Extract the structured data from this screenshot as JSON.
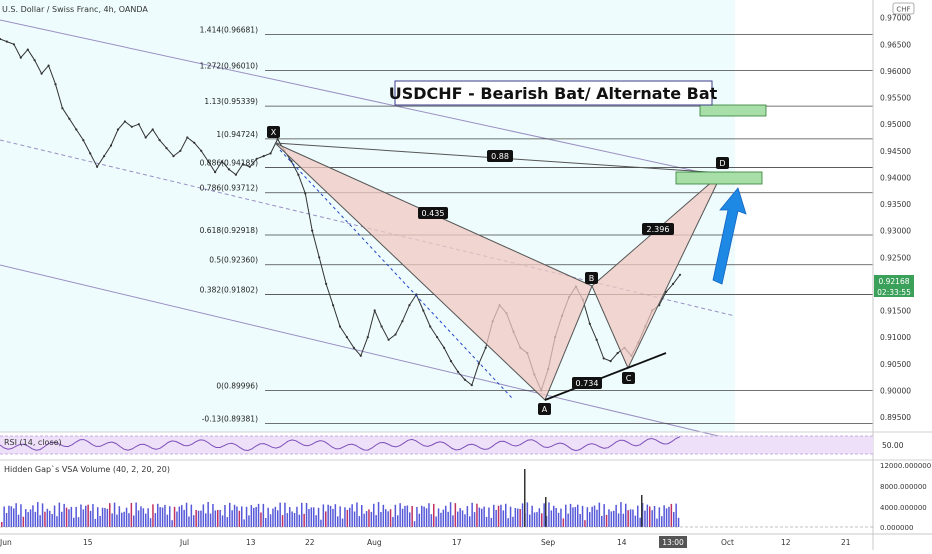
{
  "header": {
    "symbol_title": "U.S. Dollar / Swiss Franc, 4h, OANDA",
    "currency_badge": "CHF"
  },
  "annotation_title": "USDCHF - Bearish Bat/ Alternate Bat",
  "price_axis": {
    "ticks": [
      "0.97000",
      "0.96500",
      "0.96000",
      "0.95500",
      "0.95000",
      "0.94500",
      "0.94000",
      "0.93500",
      "0.93000",
      "0.92500",
      "0.92000",
      "0.91500",
      "0.91000",
      "0.90500",
      "0.90000",
      "0.89500"
    ],
    "current_price": "0.92168",
    "countdown": "02:33:55"
  },
  "time_axis": {
    "labels": [
      "Jun",
      "15",
      "Jul",
      "13",
      "22",
      "Aug",
      "17",
      "Sep",
      "14",
      "13:00",
      "Oct",
      "12",
      "21"
    ]
  },
  "fib_levels": [
    {
      "label": "1.414(0.96681)",
      "price": 0.96681
    },
    {
      "label": "1.272(0.96010)",
      "price": 0.9601
    },
    {
      "label": "1.13(0.95339)",
      "price": 0.95339
    },
    {
      "label": "1(0.94724)",
      "price": 0.94724
    },
    {
      "label": "0.886(0.94185)",
      "price": 0.94185
    },
    {
      "label": "0.786(0.93712)",
      "price": 0.93712
    },
    {
      "label": "0.618(0.92918)",
      "price": 0.92918
    },
    {
      "label": "0.5(0.92360)",
      "price": 0.9236
    },
    {
      "label": "0.382(0.91802)",
      "price": 0.91802
    },
    {
      "label": "0(0.89996)",
      "price": 0.89996
    },
    {
      "label": "-0.13(0.89381)",
      "price": 0.89381
    }
  ],
  "pattern": {
    "points": {
      "X": "X",
      "A": "A",
      "B": "B",
      "C": "C",
      "D": "D"
    },
    "ratios": {
      "xa_bd": "0.88",
      "xb": "0.435",
      "bd": "2.396",
      "ac": "0.734"
    }
  },
  "rsi": {
    "label": "RSI (14, close)",
    "value": "50.00"
  },
  "volume": {
    "label": "Hidden Gap`s VSA Volume (40, 2, 20, 20)",
    "ticks": [
      "12000.000000",
      "8000.000000",
      "4000.000000",
      "0.000000"
    ]
  },
  "colors": {
    "channel_fill": "#e0fafc",
    "pattern_fill": "#f0c8c0",
    "target_box": "#a8dfa8",
    "arrow": "#1e88e5",
    "rsi_band": "#ede0f8",
    "volume_bar": "#5558d8"
  },
  "chart_data": {
    "type": "line",
    "series": [
      {
        "values": [
          0.966,
          0.9655,
          0.965,
          0.9625,
          0.964,
          0.962,
          0.9595,
          0.961,
          0.9575,
          0.953,
          0.951,
          0.949,
          0.947,
          0.9445,
          0.942,
          0.944,
          0.946,
          0.949,
          0.9505,
          0.9495,
          0.95,
          0.9475,
          0.949,
          0.947,
          0.9455,
          0.944,
          0.945,
          0.9475,
          0.9465,
          0.945,
          0.943,
          0.941,
          0.943,
          0.9415,
          0.9405,
          0.9425,
          0.942,
          0.9435,
          0.944,
          0.9445,
          0.9472,
          0.945,
          0.943,
          0.9405,
          0.937,
          0.93,
          0.925,
          0.92,
          0.916,
          0.912,
          0.91,
          0.908,
          0.9065,
          0.91,
          0.915,
          0.912,
          0.9095,
          0.9105,
          0.913,
          0.916,
          0.918,
          0.915,
          0.912,
          0.91,
          0.908,
          0.9055,
          0.9035,
          0.902,
          0.901,
          0.905,
          0.908,
          0.913,
          0.916,
          0.9145,
          0.911,
          0.908,
          0.907,
          0.903,
          0.9,
          0.904,
          0.91,
          0.914,
          0.9175,
          0.9195,
          0.917,
          0.9125,
          0.9095,
          0.906,
          0.9055,
          0.907,
          0.908,
          0.9065,
          0.909,
          0.912,
          0.915,
          0.916,
          0.9185,
          0.92,
          0.9217
        ]
      }
    ],
    "ylim": [
      0.8935,
      0.9705
    ]
  }
}
